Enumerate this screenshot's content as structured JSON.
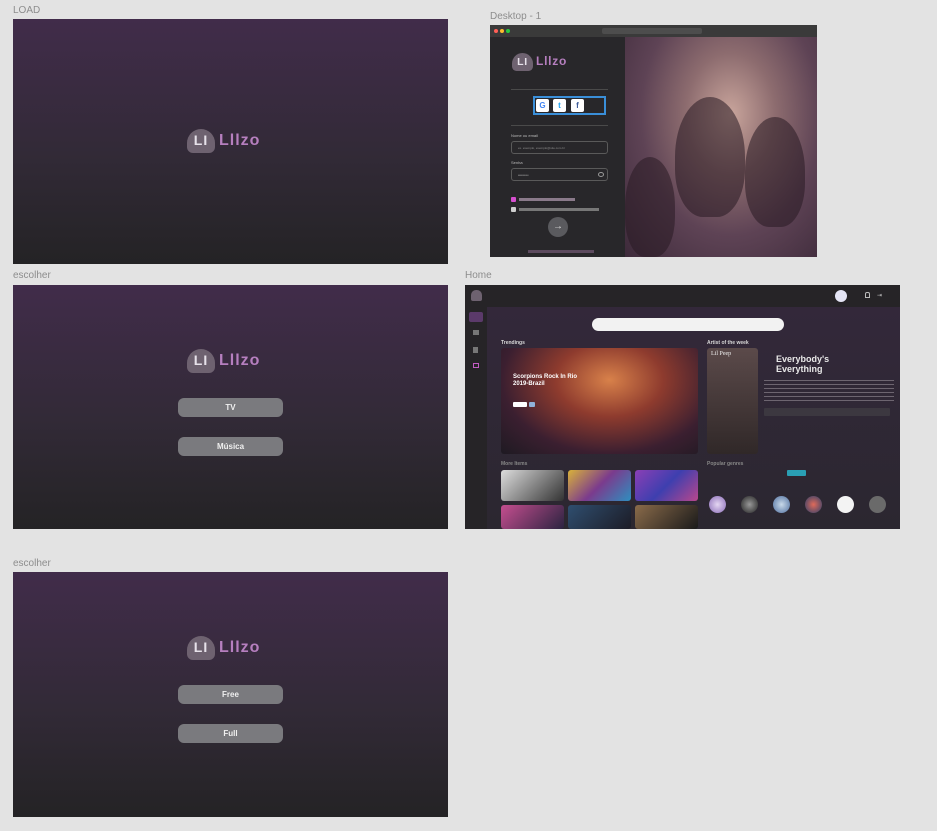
{
  "frames": {
    "load": {
      "label": "LOAD"
    },
    "desktop": {
      "label": "Desktop - 1"
    },
    "escolher1": {
      "label": "escolher"
    },
    "home": {
      "label": "Home"
    },
    "escolher2": {
      "label": "escolher"
    }
  },
  "brand": {
    "mark": "LI",
    "name": "Lllzo"
  },
  "escolher1": {
    "buttons": [
      "TV",
      "Música"
    ]
  },
  "escolher2": {
    "buttons": [
      "Free",
      "Full"
    ]
  },
  "desktop": {
    "email_label": "Nome ou email",
    "email_placeholder": "ex. exemplo, exemplo@site.com.br",
    "password_label": "Senha",
    "password_value": "••••••••••",
    "social": [
      "G",
      "t",
      "f"
    ]
  },
  "home": {
    "trendings": "Trendings",
    "artist_of_week": "Artist of the week",
    "artist_card": "Lil Peep",
    "featured_title_1": "Scorpions  Rock In Rio",
    "featured_title_2": "2019-Brazil",
    "song_title_1": "Everybody's",
    "song_title_2": "Everything",
    "more_items": "More Items",
    "popular_genres": "Popular genres"
  },
  "colors": {
    "accent": "#b67fbf",
    "frame_top": "#412c4a",
    "frame_bottom": "#242325",
    "highlight": "#3a8fd9",
    "genre_active": "#2a9fb4"
  }
}
